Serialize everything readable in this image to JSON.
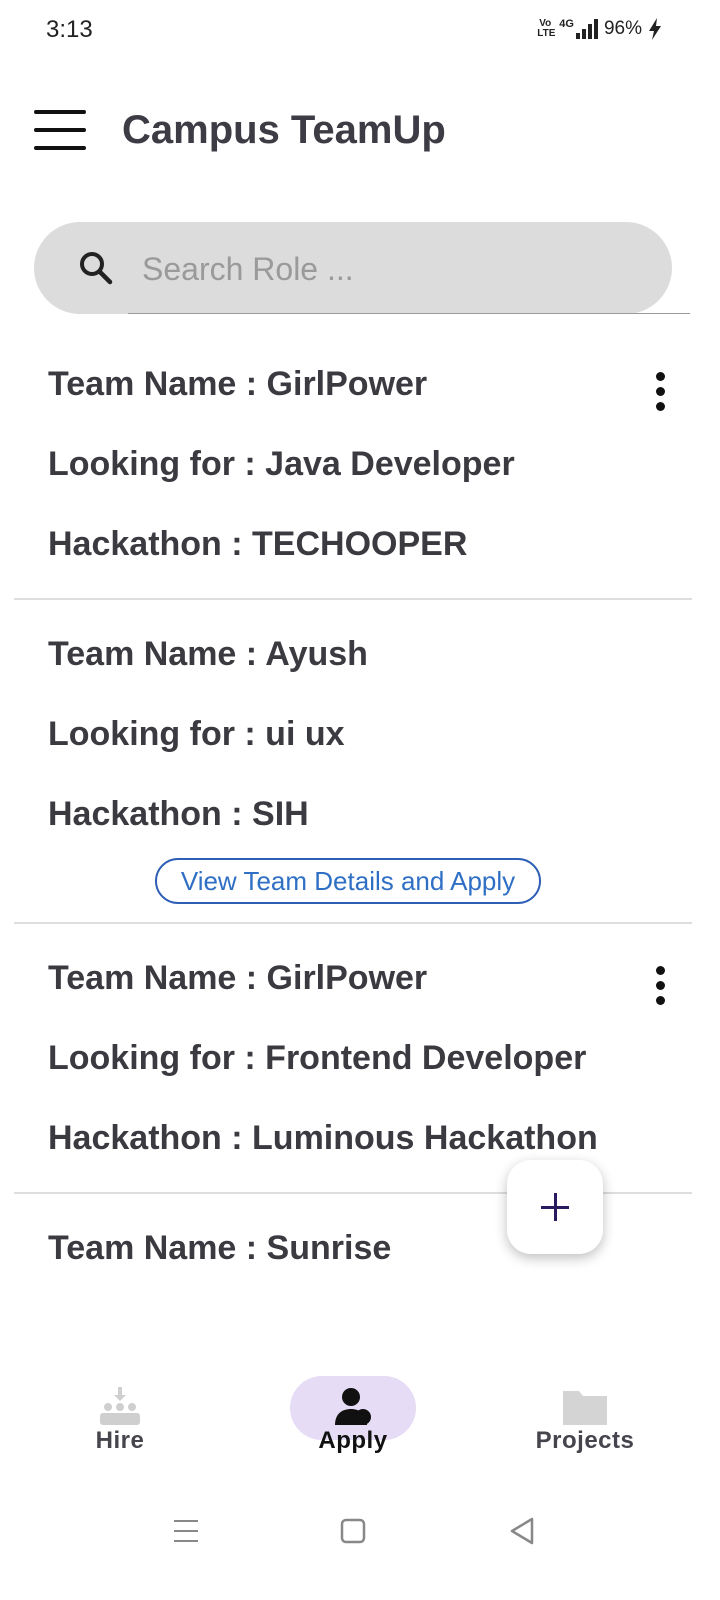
{
  "status_bar": {
    "time": "3:13",
    "volte": "Vo LTE",
    "network": "4G",
    "battery": "96%"
  },
  "app_bar": {
    "title": "Campus TeamUp"
  },
  "search": {
    "placeholder": "Search Role ..."
  },
  "teams": [
    {
      "name_row": "Team Name : GirlPower",
      "role_row": "Looking for  : Java Developer",
      "hackathon_row": "Hackathon   : TECHOOPER",
      "has_menu": true,
      "has_apply": false
    },
    {
      "name_row": "Team Name : Ayush",
      "role_row": "Looking for  : ui ux",
      "hackathon_row": "Hackathon   : SIH",
      "has_menu": false,
      "has_apply": true,
      "apply_label": "View Team Details and Apply"
    },
    {
      "name_row": "Team Name : GirlPower",
      "role_row": "Looking for  : Frontend Developer",
      "hackathon_row": "Hackathon   : Luminous Hackathon",
      "has_menu": true,
      "has_apply": false
    },
    {
      "name_row": "Team Name : Sunrise"
    }
  ],
  "fab": {
    "icon": "plus-icon"
  },
  "bottom_nav": {
    "items": [
      {
        "label": "Hire",
        "icon": "group-icon"
      },
      {
        "label": "Apply",
        "icon": "person-icon",
        "active": true
      },
      {
        "label": "Projects",
        "icon": "folder-icon"
      }
    ],
    "active_color": "#e6dcf5"
  },
  "colors": {
    "accent": "#2f6fc4",
    "title": "#3d3b44",
    "search_bg": "#dcdcdc"
  }
}
